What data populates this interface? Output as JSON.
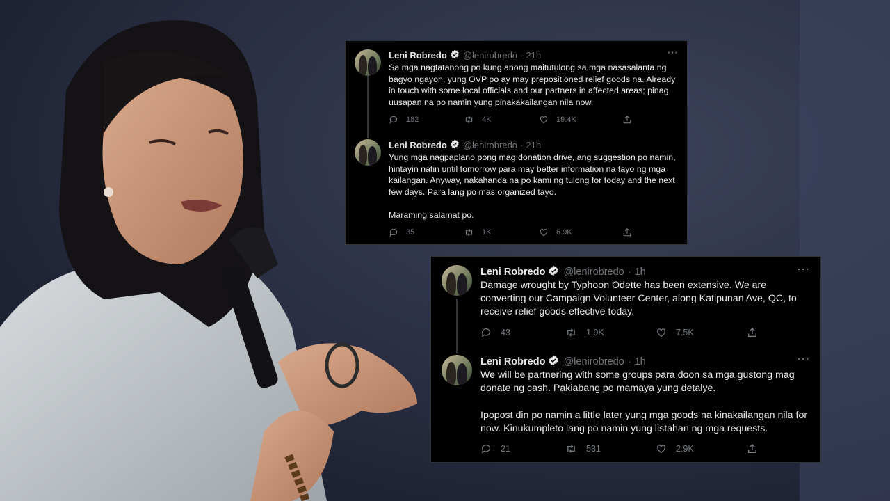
{
  "colors": {
    "card_bg": "#000000",
    "text": "#e7e9ea",
    "muted": "#71767b",
    "verified": "#e7e9ea"
  },
  "icons": [
    "reply-icon",
    "retweet-icon",
    "like-icon",
    "share-icon",
    "verified-badge-icon",
    "more-icon"
  ],
  "tweets": [
    {
      "name": "Leni Robredo",
      "handle": "@lenirobredo",
      "dot": "·",
      "time": "21h",
      "more": "···",
      "text": "Sa mga nagtatanong po kung anong maitutulong sa mga nasasalanta ng bagyo ngayon, yung OVP po ay may prepositioned relief goods na. Already in touch with some local officials and our partners in affected areas; pinag uusapan na po namin yung pinakakailangan nila now.",
      "replies": "182",
      "retweets": "4K",
      "likes": "19.4K"
    },
    {
      "name": "Leni Robredo",
      "handle": "@lenirobredo",
      "dot": "·",
      "time": "21h",
      "more": "···",
      "text": "Yung mga nagpaplano pong mag donation drive, ang suggestion po namin, hintayin natin until tomorrow para may better information na tayo ng mga kailangan. Anyway, nakahanda na po kami ng tulong for today and the next few days. Para lang po mas organized tayo.\n\nMaraming salamat po.",
      "replies": "35",
      "retweets": "1K",
      "likes": "6.9K"
    },
    {
      "name": "Leni Robredo",
      "handle": "@lenirobredo",
      "dot": "·",
      "time": "1h",
      "more": "···",
      "text": "Damage wrought by Typhoon Odette has been extensive. We are converting our Campaign Volunteer Center, along Katipunan Ave, QC, to receive relief goods effective today.",
      "replies": "43",
      "retweets": "1.9K",
      "likes": "7.5K"
    },
    {
      "name": "Leni Robredo",
      "handle": "@lenirobredo",
      "dot": "·",
      "time": "1h",
      "more": "···",
      "text": "We will be partnering with some groups para doon sa mga gustong mag donate ng cash. Pakiabang po mamaya yung detalye.\n\nIpopost din po namin a little later yung mga goods na kinakailangan nila for now. Kinukumpleto lang po namin yung listahan ng mga requests.",
      "replies": "21",
      "retweets": "531",
      "likes": "2.9K"
    }
  ]
}
